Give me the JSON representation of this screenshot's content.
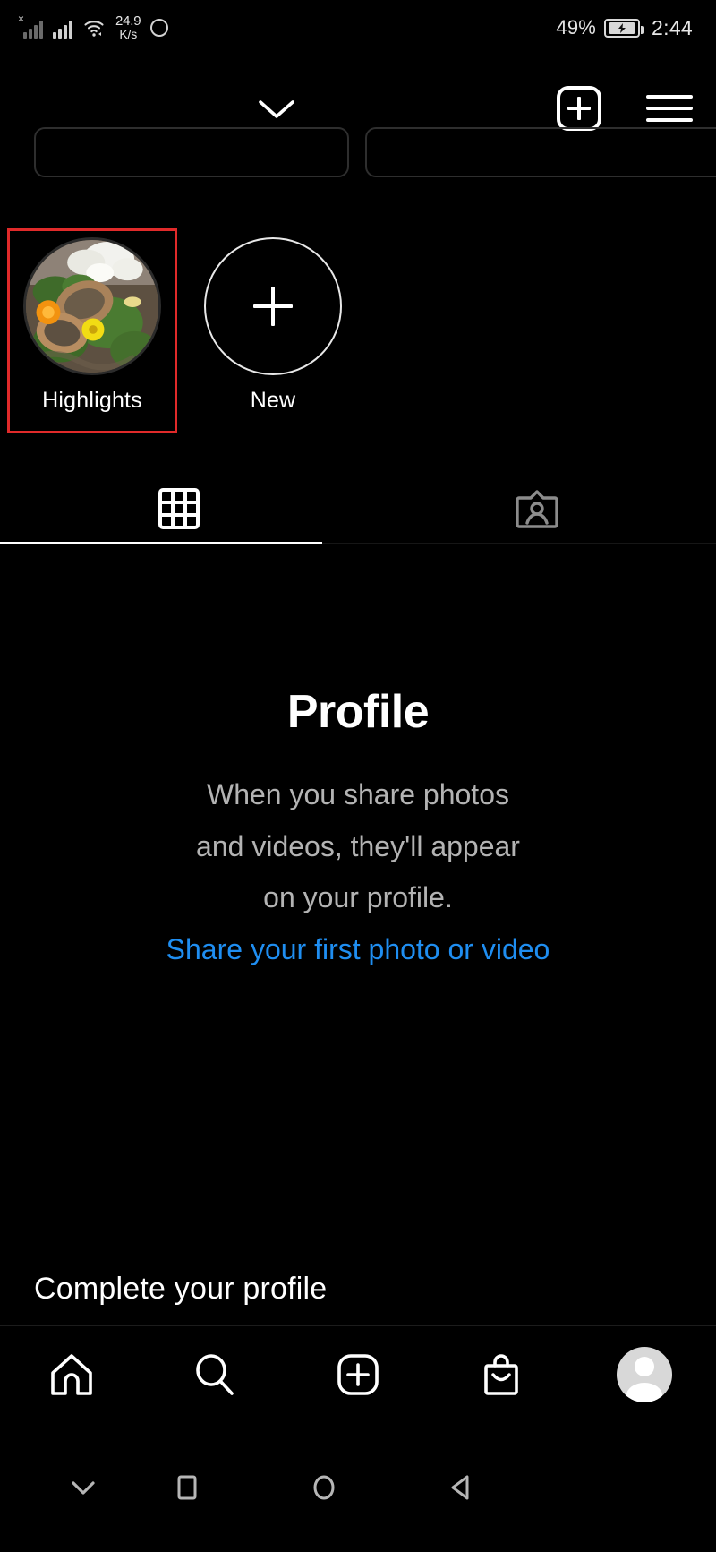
{
  "status_bar": {
    "network_speed_value": "24.9",
    "network_speed_unit": "K/s",
    "battery_percent": "49%",
    "time": "2:44",
    "icons": [
      "signal-no-service-icon",
      "signal-bars-icon",
      "wifi-icon",
      "navigation-circle-icon",
      "battery-charging-icon"
    ]
  },
  "header": {
    "chevron_icon": "chevron-down-icon",
    "add_icon": "add-post-icon",
    "menu_icon": "hamburger-menu-icon"
  },
  "highlights": {
    "items": [
      {
        "label": "Highlights",
        "thumb": "flower-pots-photo",
        "selected": true
      },
      {
        "label": "New",
        "thumb": "plus-icon",
        "selected": false
      }
    ],
    "selection_color": "#e02a2a"
  },
  "tabs": [
    {
      "name": "grid-tab",
      "icon": "grid-icon",
      "active": true
    },
    {
      "name": "tagged-tab",
      "icon": "tagged-person-icon",
      "active": false
    }
  ],
  "empty_state": {
    "title": "Profile",
    "body_line_1": "When you share photos",
    "body_line_2": "and videos, they'll appear",
    "body_line_3": "on your profile.",
    "link_text": "Share your first photo or video",
    "link_color": "#1f8ef1",
    "body_color": "#b3b3b3"
  },
  "complete_profile": {
    "title": "Complete your profile"
  },
  "bottom_nav": {
    "items": [
      {
        "name": "home",
        "icon": "home-icon"
      },
      {
        "name": "search",
        "icon": "search-icon"
      },
      {
        "name": "create",
        "icon": "add-post-icon"
      },
      {
        "name": "shop",
        "icon": "shopping-bag-icon"
      },
      {
        "name": "profile",
        "icon": "avatar-icon"
      }
    ]
  },
  "system_nav": {
    "items": [
      {
        "name": "hide-keyboard",
        "icon": "chevron-down-icon"
      },
      {
        "name": "recents",
        "icon": "square-icon"
      },
      {
        "name": "home",
        "icon": "circle-icon"
      },
      {
        "name": "back",
        "icon": "triangle-back-icon"
      }
    ]
  }
}
